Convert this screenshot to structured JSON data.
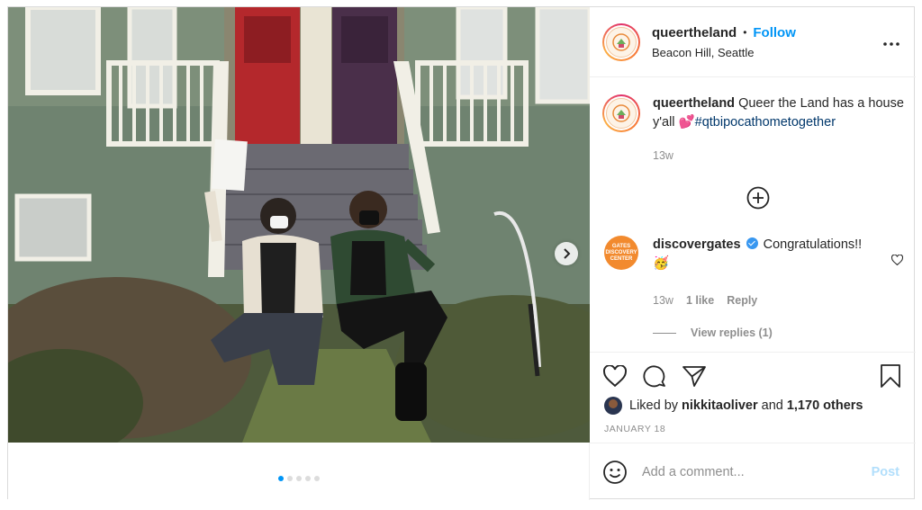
{
  "post": {
    "username": "queertheland",
    "follow_label": "Follow",
    "separator": "•",
    "location": "Beacon Hill, Seattle"
  },
  "caption": {
    "username": "queertheland",
    "text": " Queer the Land has a house y'all ",
    "emoji": "💕",
    "hashtag": "#qtbipocathometogether",
    "time": "13w"
  },
  "comment": {
    "username": "discovergates",
    "avatar_text": "GATES DISCOVERY CENTER",
    "text": " Congratulations!! 🥳",
    "time": "13w",
    "likes": "1 like",
    "reply_label": "Reply",
    "view_replies": "View replies (1)"
  },
  "likes": {
    "prefix": "Liked by",
    "user": "nikkitaoliver",
    "joiner": "and",
    "others": "1,170 others"
  },
  "date": "JANUARY 18",
  "add_comment": {
    "placeholder": "Add a comment...",
    "post_label": "Post"
  },
  "carousel": {
    "count": 5,
    "active_index": 0
  },
  "colors": {
    "accent": "#0095f6",
    "hashtag": "#00376b",
    "muted": "#8e8e8e",
    "post_disabled": "#b2dffc"
  },
  "icons": [
    "more-icon",
    "heart-icon",
    "comment-icon",
    "share-icon",
    "bookmark-icon",
    "emoji-icon",
    "plus-circle-icon",
    "chevron-right-icon",
    "verified-icon"
  ]
}
